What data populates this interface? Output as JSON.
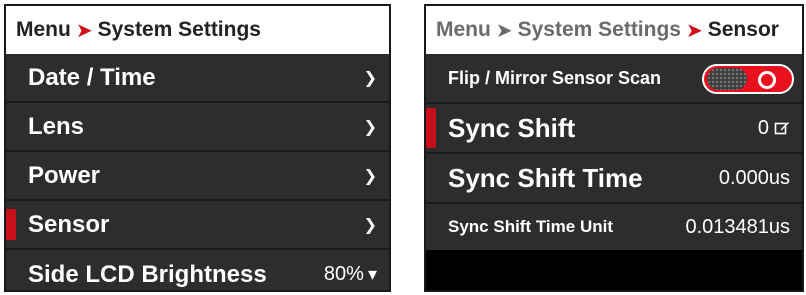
{
  "left": {
    "breadcrumb": [
      "Menu",
      "System Settings"
    ],
    "items": [
      {
        "label": "Date / Time",
        "value": "",
        "icon": "chevron-right-icon"
      },
      {
        "label": "Lens",
        "value": "",
        "icon": "chevron-right-icon"
      },
      {
        "label": "Power",
        "value": "",
        "icon": "chevron-right-icon"
      },
      {
        "label": "Sensor",
        "value": "",
        "icon": "chevron-right-icon"
      },
      {
        "label": "Side LCD Brightness",
        "value": "80%",
        "icon": "chevron-down-icon"
      }
    ],
    "selected_index": 3
  },
  "right": {
    "breadcrumb": [
      "Menu",
      "System Settings",
      "Sensor"
    ],
    "items": [
      {
        "label": "Flip / Mirror Sensor Scan",
        "value": "",
        "toggle": "on"
      },
      {
        "label": "Sync Shift",
        "value": "0",
        "icon": "edit-icon"
      },
      {
        "label": "Sync Shift Time",
        "value": "0.000us"
      },
      {
        "label": "Sync Shift Time Unit",
        "value": "0.013481us"
      }
    ],
    "selected_index": 1
  },
  "glyphs": {
    "chevron_right": "➤",
    "chevron_small": "❯",
    "chevron_down": "▾"
  },
  "colors": {
    "accent_red": "#d0101b",
    "panel_bg": "#2d2d2d",
    "header_bg": "#ffffff"
  }
}
